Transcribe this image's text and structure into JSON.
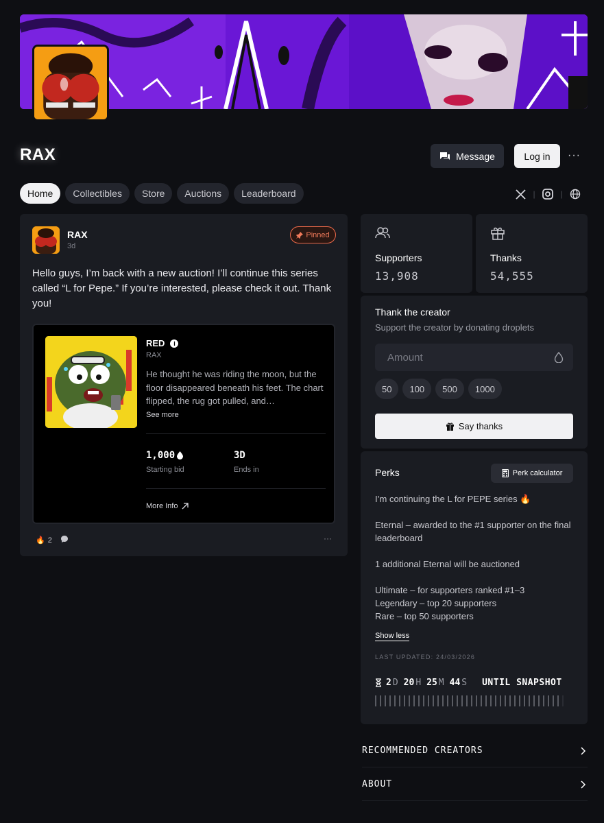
{
  "profile": {
    "name": "RAX",
    "message_label": "Message",
    "login_label": "Log in",
    "more_label": "···"
  },
  "tabs": [
    {
      "label": "Home",
      "active": true
    },
    {
      "label": "Collectibles",
      "active": false
    },
    {
      "label": "Store",
      "active": false
    },
    {
      "label": "Auctions",
      "active": false
    },
    {
      "label": "Leaderboard",
      "active": false
    }
  ],
  "socials": [
    "x-icon",
    "instagram-icon",
    "globe-icon"
  ],
  "post": {
    "author": "RAX",
    "time": "3d",
    "pinned_label": "Pinned",
    "body": "Hello guys, I’m back with a new auction! I’ll continue this series called “L for Pepe.” If you’re interested, please check it out. Thank you!",
    "auction": {
      "title": "RED",
      "artist": "RAX",
      "description": "He thought he was riding the moon, but the floor disappeared beneath his feet. The chart flipped, the rug got pulled, and…",
      "see_more": "See more",
      "bid_value": "1,000",
      "bid_label": "Starting bid",
      "ends_value": "3D",
      "ends_label": "Ends in",
      "more_info": "More Info"
    },
    "fire_count": "2"
  },
  "stats": {
    "supporters_label": "Supporters",
    "supporters_value": "13,908",
    "thanks_label": "Thanks",
    "thanks_value": "54,555"
  },
  "thank": {
    "title": "Thank the creator",
    "subtitle": "Support the creator by donating droplets",
    "amount_placeholder": "Amount",
    "presets": [
      "50",
      "100",
      "500",
      "1000"
    ],
    "button_label": "Say thanks"
  },
  "perks": {
    "title": "Perks",
    "calculator_label": "Perk calculator",
    "line1": "I’m continuing the L for PEPE series 🔥",
    "line2": "Eternal – awarded to the #1 supporter on the final leaderboard",
    "line3": "1 additional Eternal will be auctioned",
    "line4": "Ultimate – for supporters ranked #1–3",
    "line5": "Legendary – top 20 supporters",
    "line6": "Rare – top 50 supporters",
    "show_less": "Show less",
    "last_updated": "LAST UPDATED: 24/03/2026",
    "countdown": {
      "d": "2",
      "d_unit": "D",
      "h": "20",
      "h_unit": "H",
      "m": "25",
      "m_unit": "M",
      "s": "44",
      "s_unit": "S",
      "until": "UNTIL SNAPSHOT"
    }
  },
  "accordions": {
    "recommended": "RECOMMENDED CREATORS",
    "about": "ABOUT"
  },
  "colors": {
    "background": "#0e0f13",
    "card": "#1a1c22",
    "pinned": "#ef6a4a",
    "banner": "#6a17d6"
  }
}
